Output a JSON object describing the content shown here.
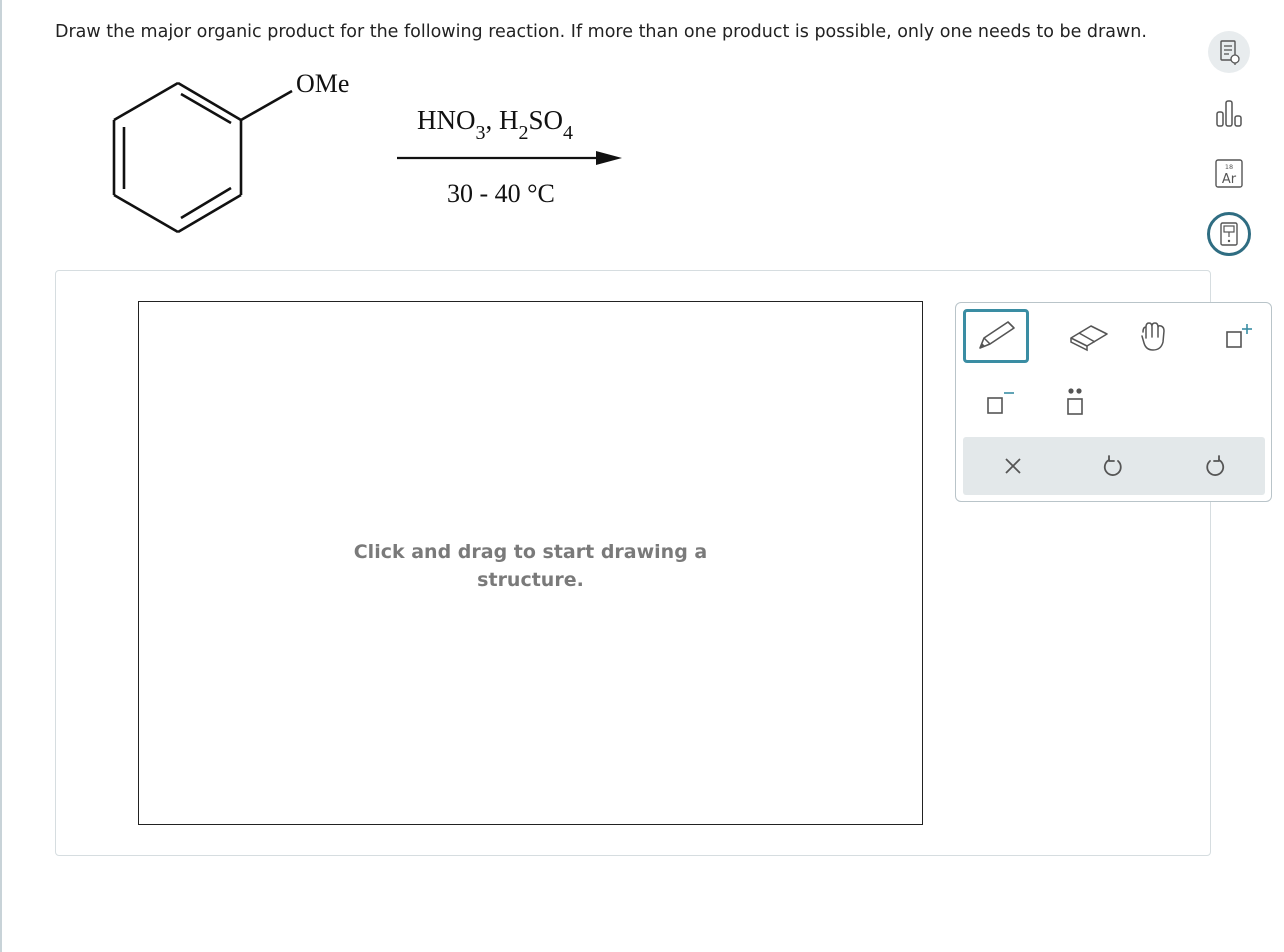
{
  "question": "Draw the major organic product for the following reaction. If more than one product is possible, only one needs to be drawn.",
  "reaction": {
    "substituent": "OMe",
    "reagent_main": "HNO",
    "reagent_sub1": "3",
    "reagent_comma": ",",
    "reagent_h": "H",
    "reagent_sub2": "2",
    "reagent_so": "SO",
    "reagent_sub3": "4",
    "conditions": "30 - 40 °C"
  },
  "sidebar_icons": [
    "question-clipboard-icon",
    "bar-chart-icon",
    "periodic-table-icon",
    "calculator-icon"
  ],
  "periodic_tile": {
    "number": "18",
    "symbol": "Ar"
  },
  "canvas": {
    "hint_line1": "Click and drag to start drawing a",
    "hint_line2": "structure."
  },
  "tools": {
    "items": [
      "pencil-icon",
      "eraser-icon",
      "hand-icon",
      "positive-charge-icon",
      "negative-charge-icon",
      "lone-pair-icon"
    ],
    "actions": [
      "clear-icon",
      "undo-icon",
      "redo-icon"
    ],
    "active": "pencil-icon",
    "accent_color": "#3a8da3"
  }
}
